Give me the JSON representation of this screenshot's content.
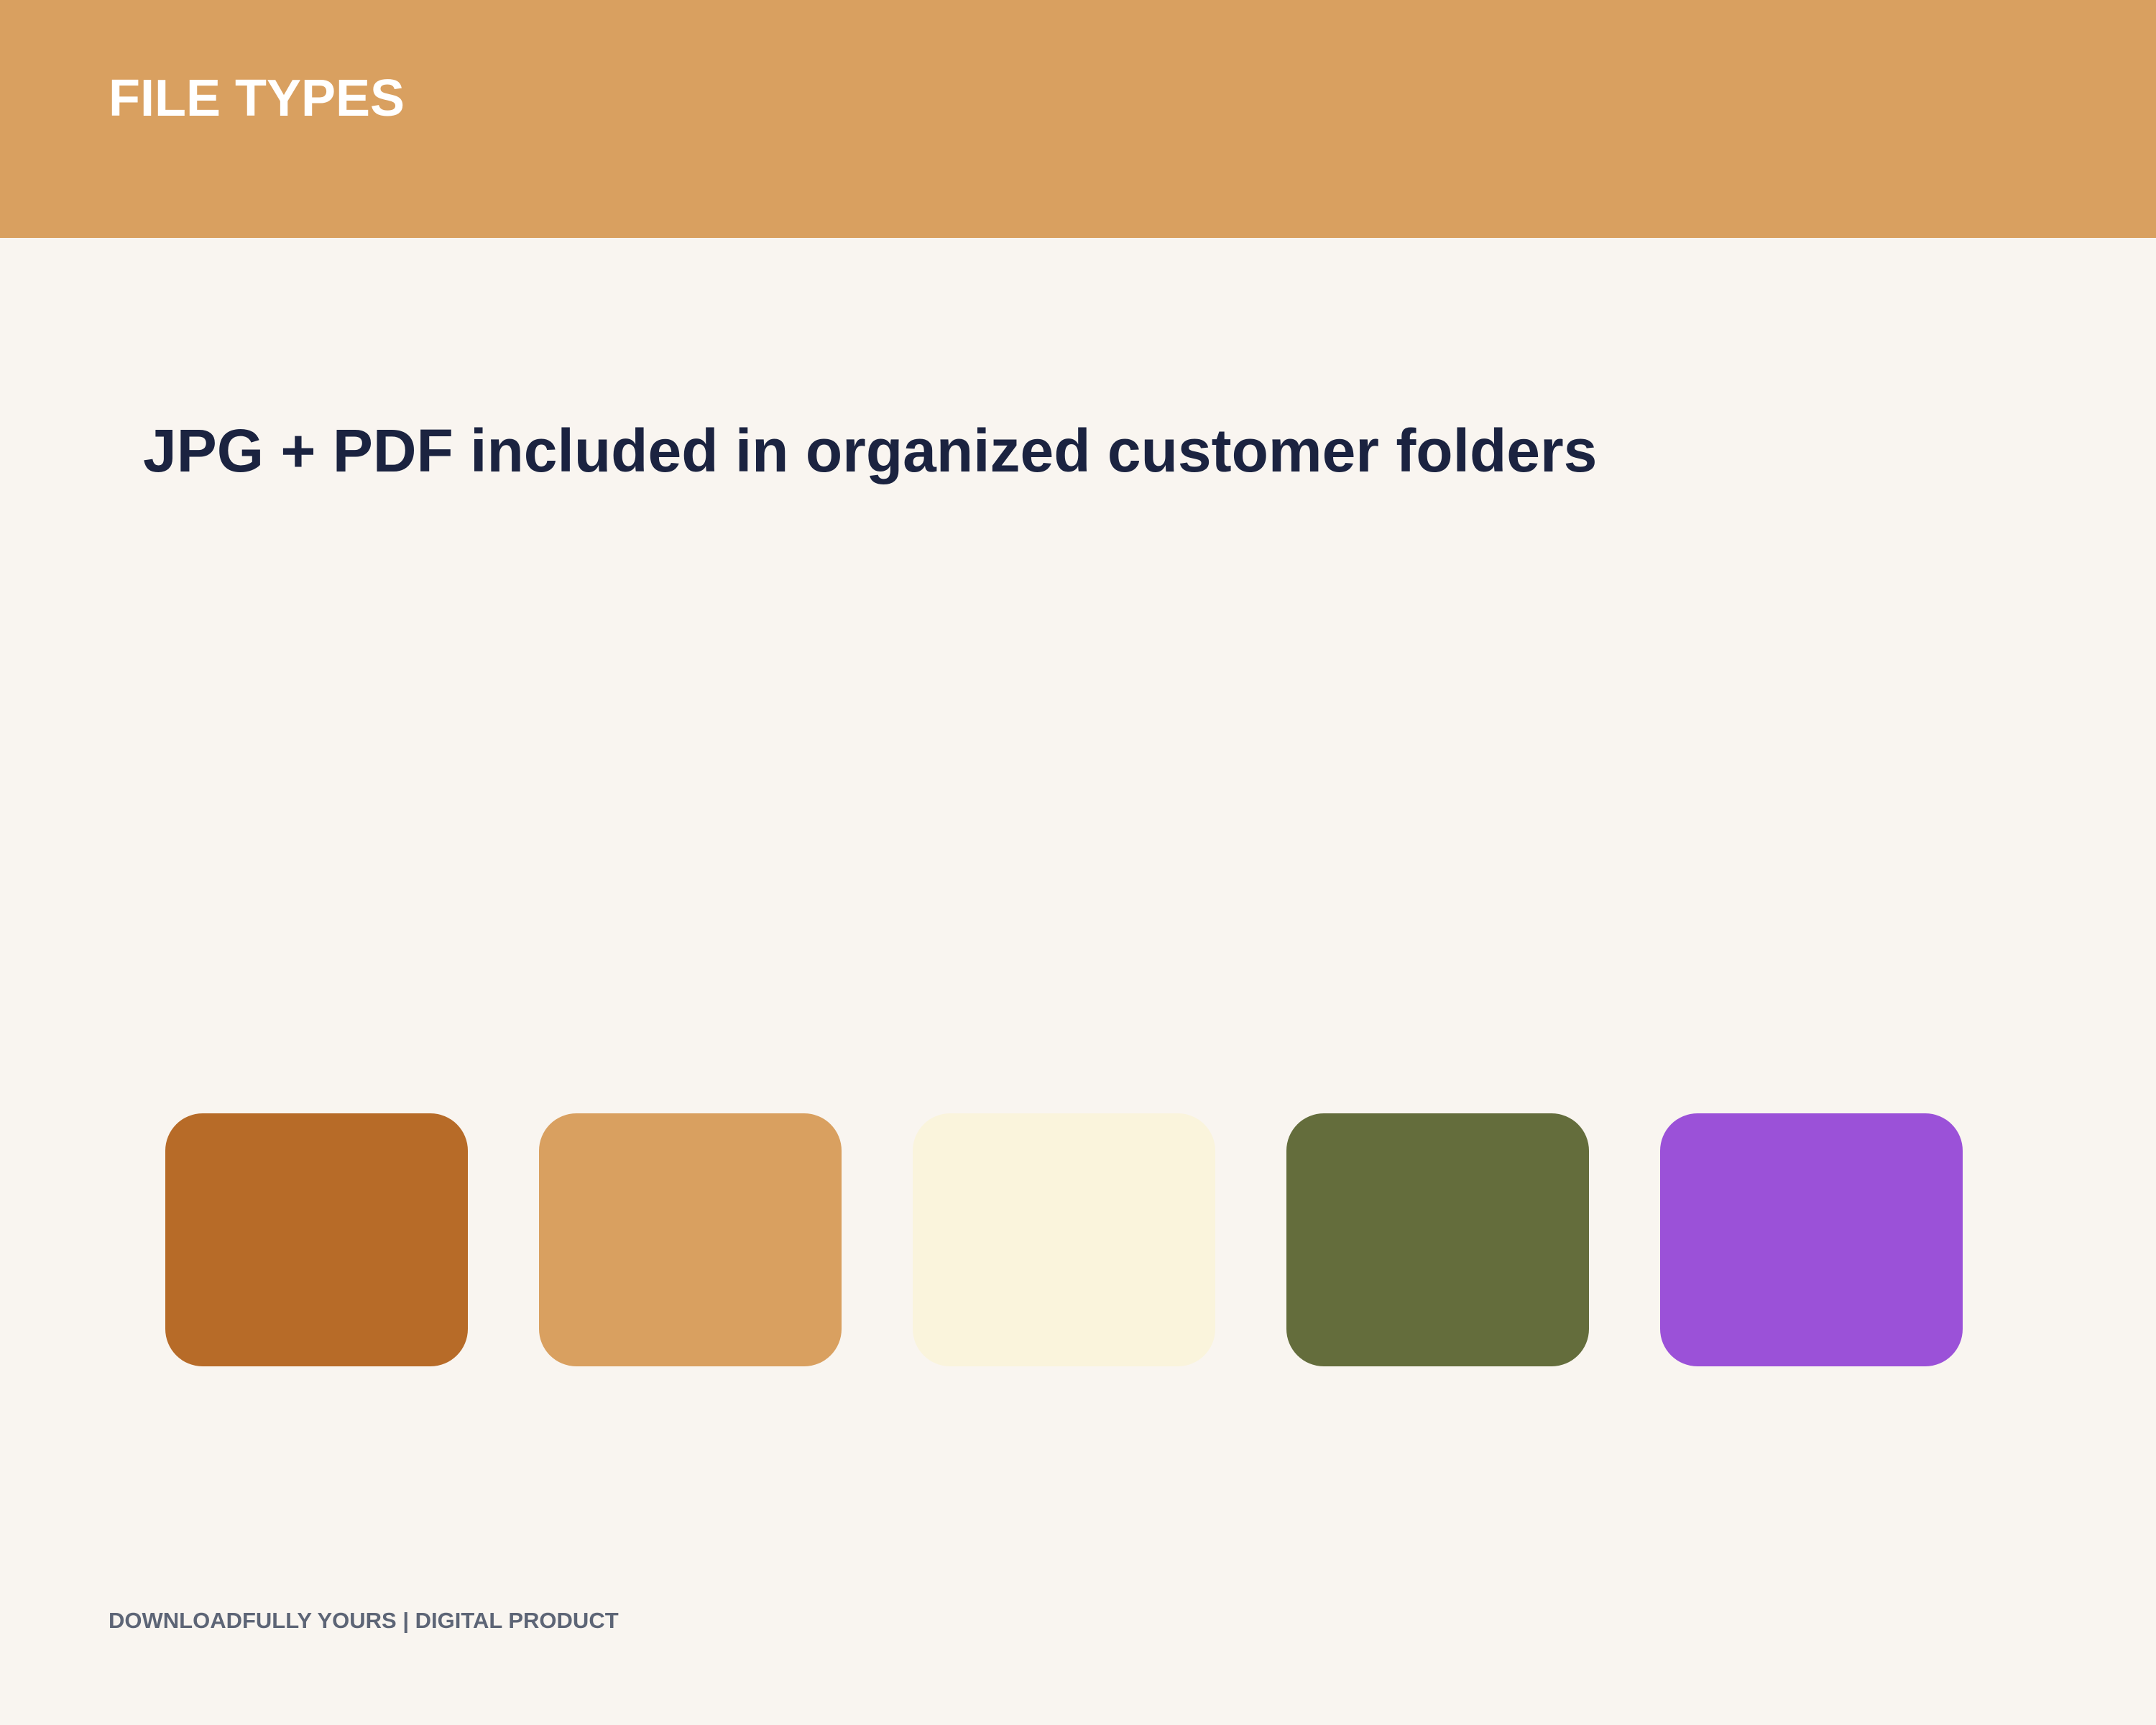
{
  "header": {
    "title": "FILE TYPES",
    "background_color": "#d9a060"
  },
  "main": {
    "headline": "JPG + PDF included in organized customer folders"
  },
  "swatches": [
    {
      "color": "#b76b28"
    },
    {
      "color": "#d9a060"
    },
    {
      "color": "#faf4dc"
    },
    {
      "color": "#646d3c"
    },
    {
      "color": "#9b51d8"
    }
  ],
  "footer": {
    "text": "DOWNLOADFULLY YOURS | DIGITAL PRODUCT"
  }
}
